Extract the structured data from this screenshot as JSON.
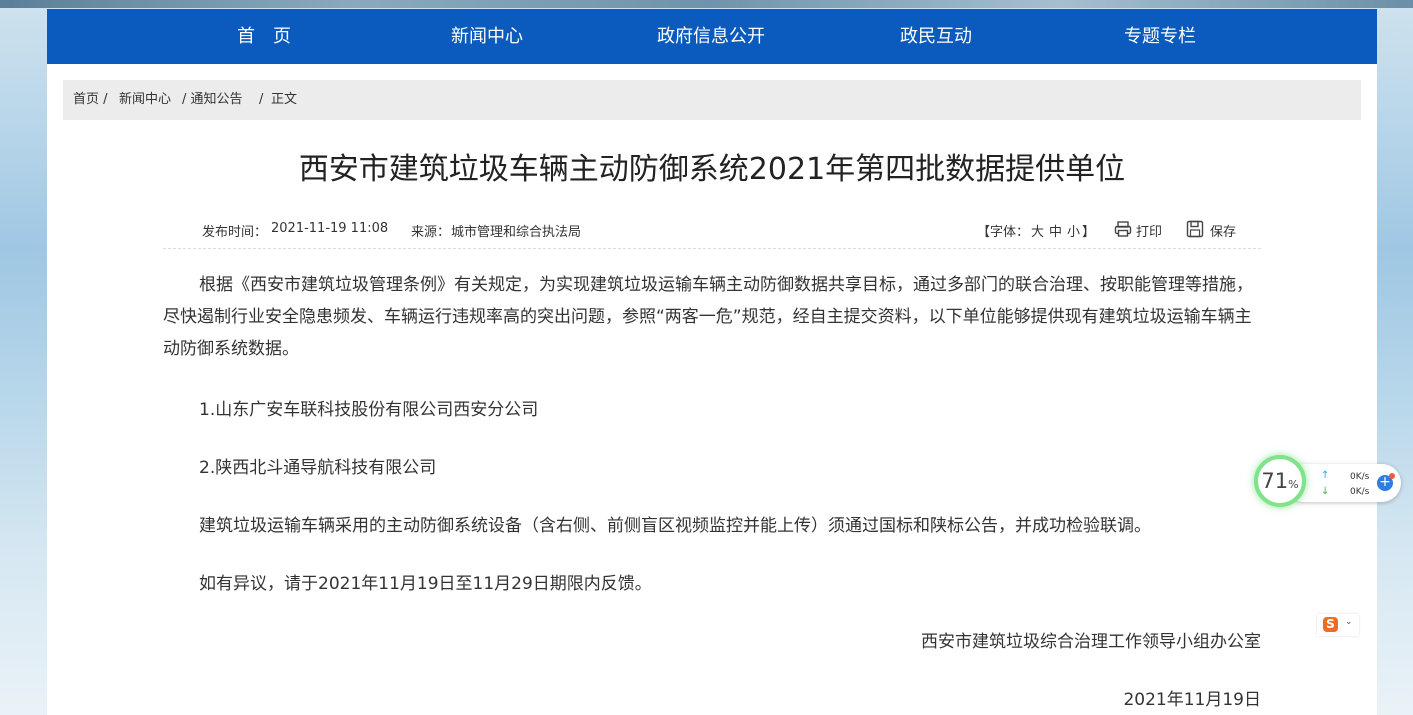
{
  "nav": {
    "items": [
      "首　页",
      "新闻中心",
      "政府信息公开",
      "政民互动",
      "专题专栏"
    ]
  },
  "breadcrumb": {
    "items": [
      "首页 /",
      "新闻中心",
      "/ 通知公告",
      "/",
      "正文"
    ]
  },
  "article": {
    "title": "西安市建筑垃圾车辆主动防御系统2021年第四批数据提供单位",
    "publish_label": "发布时间：",
    "publish_time": "2021-11-19 11:08",
    "source_label": "来源：",
    "source": "城市管理和综合执法局",
    "font_bracket_open": "【字体：",
    "font_large": "大",
    "font_medium": "中",
    "font_small": "小",
    "font_bracket_close": "】",
    "print_label": "打印",
    "save_label": "保存",
    "paragraph1": "根据《西安市建筑垃圾管理条例》有关规定，为实现建筑垃圾运输车辆主动防御数据共享目标，通过多部门的联合治理、按职能管理等措施，尽快遏制行业安全隐患频发、车辆运行违规率高的突出问题，参照“两客一危”规范，经自主提交资料，以下单位能够提供现有建筑垃圾运输车辆主动防御系统数据。",
    "item1": "1.山东广安车联科技股份有限公司西安分公司",
    "item2": "2.陕西北斗通导航科技有限公司",
    "paragraph2": "建筑垃圾运输车辆采用的主动防御系统设备（含右侧、前侧盲区视频监控并能上传）须通过国标和陕标公告，并成功检验联调。",
    "paragraph3": "如有异议，请于2021年11月19日至11月29日期限内反馈。",
    "signature": "西安市建筑垃圾综合治理工作领导小组办公室",
    "date": "2021年11月19日"
  },
  "speed_widget": {
    "percent": "71",
    "percent_unit": "%",
    "upload": "0K/s",
    "download": "0K/s",
    "ring_color": "#7ee389"
  },
  "colors": {
    "nav_bg": "#0a5bbd",
    "breadcrumb_bg": "#ececec"
  },
  "icons": {
    "print": "printer-icon",
    "save": "floppy-disk-icon",
    "ime": "sogou-s-icon"
  }
}
